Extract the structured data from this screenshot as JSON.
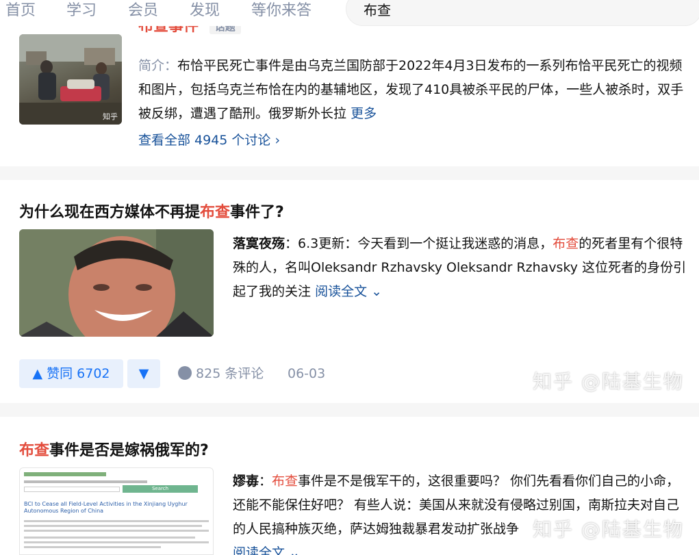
{
  "nav": {
    "tabs": [
      "首页",
      "学习",
      "会员",
      "发现",
      "等你来答"
    ],
    "search_value": "布查"
  },
  "topic": {
    "title_red": "布查事件",
    "tag": "话题",
    "intro_label": "简介：",
    "intro_text": "布恰平民死亡事件是由乌克兰国防部于2022年4月3日发布的一系列布恰平民死亡的视频和图片，包括乌克兰布恰在内的基辅地区，发现了410具被杀平民的尸体，一些人被杀时，双手被反绑，遭遇了酷刑。俄罗斯外长拉",
    "more": "更多",
    "see_all": "查看全部 4945 个讨论 ›",
    "thumb_watermark": "知乎"
  },
  "answer1": {
    "title_pre": "为什么现在西方媒体不再提",
    "title_red": "布查",
    "title_post": "事件了?",
    "author": "落寞夜殇",
    "text_pre": "：6.3更新：今天看到一个挺让我迷惑的消息，",
    "text_red": "布查",
    "text_post": "的死者里有个很特殊的人，名叫Oleksandr Rzhavsky Oleksandr Rzhavsky 这位死者的身份引起了我的关注",
    "read_more": "阅读全文",
    "upvote": "▲ 赞同 6702",
    "downvote": "▼",
    "comments": "825 条评论",
    "date": "06-03"
  },
  "answer2": {
    "title_red": "布查",
    "title_post": "事件是否是嫁祸俄军的?",
    "author": "嫪毐",
    "text_pre": "：",
    "text_red": "布查",
    "text_post": "事件是不是俄军干的，这很重要吗？ 你们先看看你们自己的小命，还能不能保住好吧？ 有些人说：美国从来就没有侵略过别国，南斯拉夫对自己的人民搞种族灭绝，萨达姆独裁暴君发动扩张战争",
    "read_more": "阅读全文",
    "thumb_heading": "BCI to Cease all Field-Level Activities in the Xinjiang Uyghur Autonomous Region of China",
    "thumb_search": "Search"
  },
  "watermark": "知乎 @陆基生物"
}
